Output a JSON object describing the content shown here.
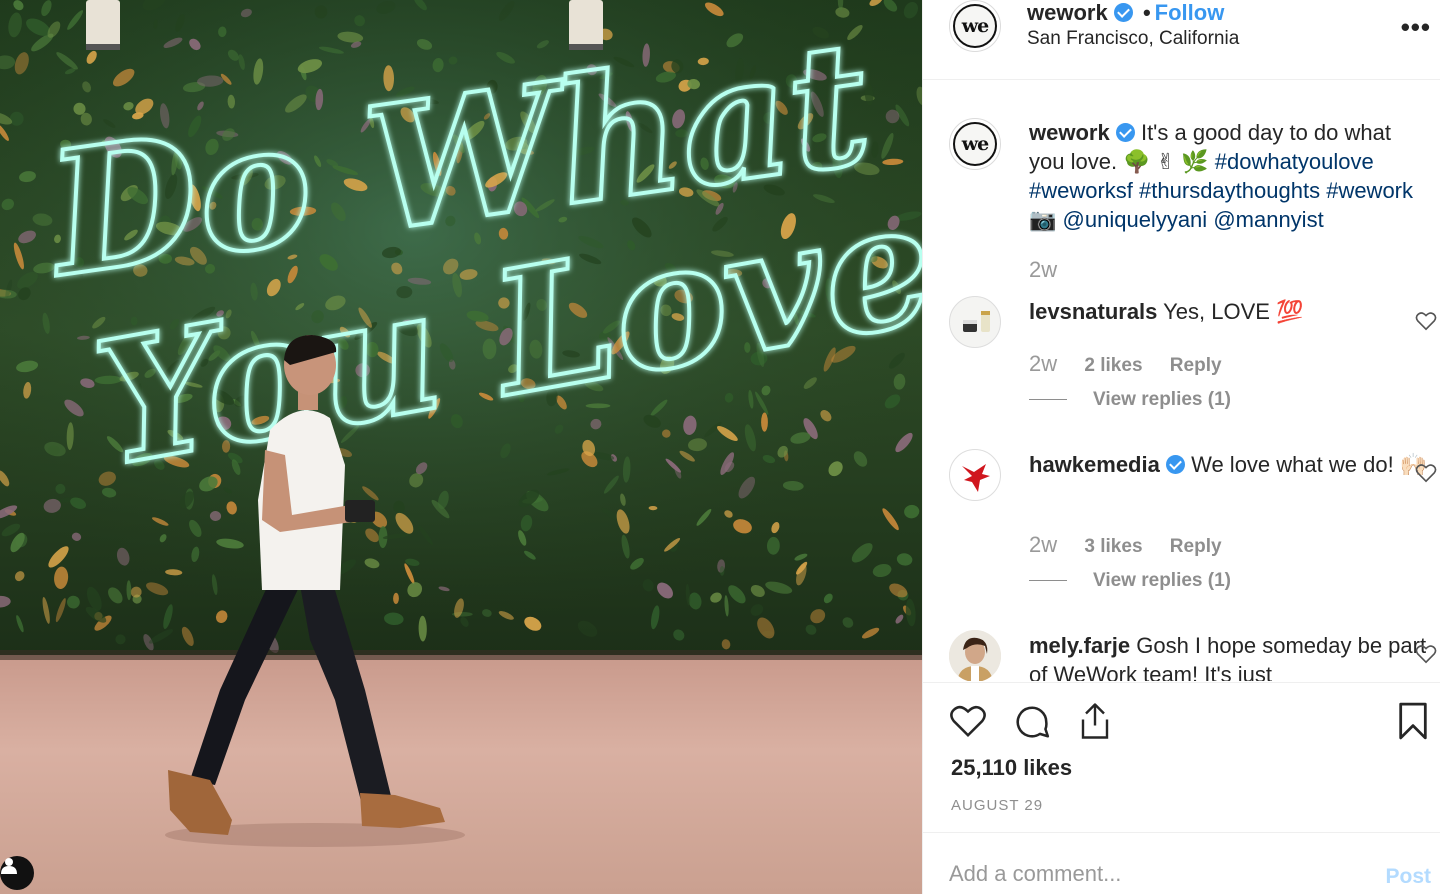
{
  "photo": {
    "sign_line1": "Do What",
    "sign_line2": "You Love"
  },
  "header": {
    "avatar_text": "we",
    "username": "wework",
    "separator": "•",
    "follow_label": "Follow",
    "location": "San Francisco, California",
    "more_label": "•••"
  },
  "caption": {
    "avatar_text": "we",
    "username": "wework",
    "text_start": "It's a good day to do what you love. 🌳 ✌ 🌿",
    "tag1": "#dowhatyoulove",
    "tag2": "#weworksf",
    "tag3": "#thursdaythoughts",
    "tag4": "#wework",
    "camera": "📷",
    "mention1": "@uniquelyyani",
    "mention2": "@mannyist",
    "time": "2w"
  },
  "comments": [
    {
      "username": "levsnaturals",
      "text": "Yes, LOVE 💯",
      "time": "2w",
      "likes": "2 likes",
      "reply": "Reply",
      "view_replies": "View replies (1)"
    },
    {
      "username": "hawkemedia",
      "text": "We love what we do! 🙌🏻",
      "time": "2w",
      "likes": "3 likes",
      "reply": "Reply",
      "view_replies": "View replies (1)"
    },
    {
      "username": "mely.farje",
      "text": "Gosh I hope someday be part of WeWork team! It's just"
    }
  ],
  "actions": {
    "likes": "25,110 likes",
    "date": "AUGUST 29"
  },
  "add_comment": {
    "placeholder": "Add a comment...",
    "post_label": "Post"
  },
  "colors": {
    "link": "#003569",
    "accent": "#3897f0",
    "post_disabled": "#b3dbff"
  }
}
